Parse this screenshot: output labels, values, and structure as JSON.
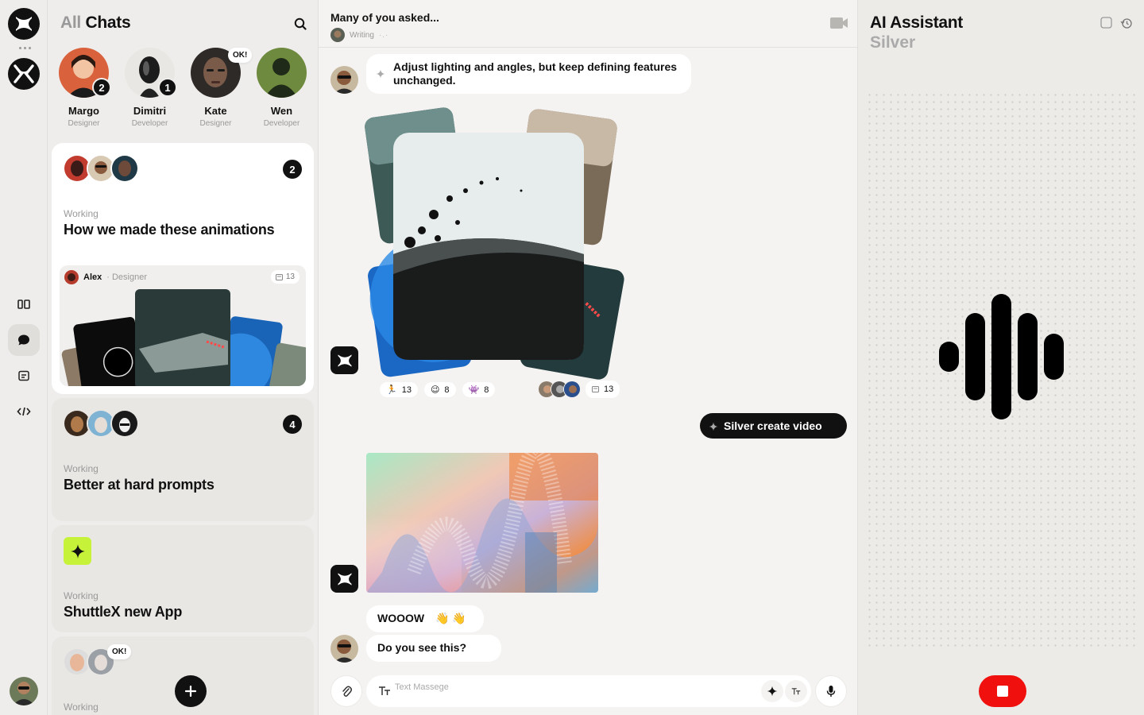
{
  "chats": {
    "title_muted": "All",
    "title": "Chats",
    "people": [
      {
        "name": "Margo",
        "role": "Designer",
        "badge": "2"
      },
      {
        "name": "Dimitri",
        "role": "Developer",
        "badge": "1"
      },
      {
        "name": "Kate",
        "role": "Designer",
        "bubble": "OK!"
      },
      {
        "name": "Wen",
        "role": "Developer"
      }
    ],
    "cards": [
      {
        "status": "Working",
        "title": "How we made these animations",
        "count": "2",
        "preview": {
          "author": "Alex",
          "role": "· Designer",
          "count": "13"
        }
      },
      {
        "status": "Working",
        "title": "Better at hard prompts",
        "count": "4"
      },
      {
        "status": "Working",
        "title": "ShuttleX new App"
      },
      {
        "status": "Working",
        "bubble": "OK!"
      }
    ]
  },
  "conversation": {
    "title": "Many of you asked...",
    "status": "Writing",
    "prompt": "Adjust lighting and angles, but keep defining features unchanged.",
    "reactions": [
      {
        "emoji": "🏃",
        "count": "13"
      },
      {
        "emoji": "😉",
        "count": "8"
      },
      {
        "emoji": "👾",
        "count": "8"
      }
    ],
    "thread_count": "13",
    "command": "Silver create video",
    "reply_1": "WOOOW",
    "reply_1_emoji": "👋 👋",
    "reply_2": "Do you see this?",
    "composer_placeholder": "Text Massege"
  },
  "assistant": {
    "title": "AI Assistant",
    "subtitle": "Silver",
    "level": 1.0
  },
  "colors": {
    "accent_lime": "#c6f33a",
    "stop_red": "#f0100e",
    "ink": "#111111"
  }
}
